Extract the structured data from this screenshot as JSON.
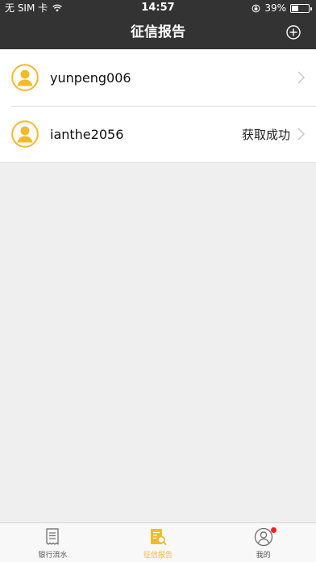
{
  "status_bar": {
    "carrier": "无 SIM 卡",
    "time": "14:57",
    "battery": "39%",
    "battery_level": 0.39
  },
  "header": {
    "title": "征信报告",
    "add_icon": "plus-circle-icon"
  },
  "accounts": [
    {
      "username": "yunpeng006",
      "status": ""
    },
    {
      "username": "ianthe2056",
      "status": "获取成功"
    }
  ],
  "tabbar": {
    "tabs": [
      {
        "label": "银行流水",
        "icon": "receipt-icon",
        "active": false
      },
      {
        "label": "征信报告",
        "icon": "credit-report-icon",
        "active": true
      },
      {
        "label": "我的",
        "icon": "profile-icon",
        "active": false,
        "badge": true
      }
    ]
  },
  "colors": {
    "header_bg": "#333333",
    "accent": "#f3ba2b",
    "background": "#efefef",
    "badge": "#ff1f1f"
  }
}
